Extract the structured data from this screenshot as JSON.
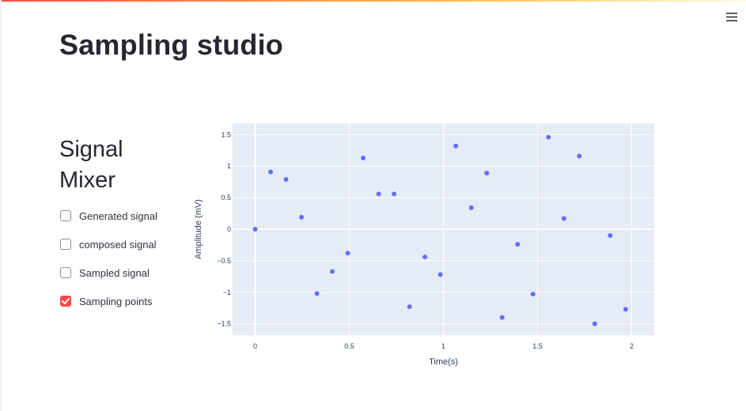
{
  "app": {
    "title": "Sampling studio",
    "menu_icon": "hamburger-menu-icon",
    "accent_color": "#ff4b4b"
  },
  "sidebar": {
    "heading": "Signal Mixer",
    "checkboxes": [
      {
        "label": "Generated signal",
        "checked": false
      },
      {
        "label": "composed signal",
        "checked": false
      },
      {
        "label": "Sampled signal",
        "checked": false
      },
      {
        "label": "Sampling points",
        "checked": true
      }
    ]
  },
  "chart_data": {
    "type": "scatter",
    "xlabel": "Time(s)",
    "ylabel": "Amplitude (mV)",
    "xlim": [
      -0.12,
      2.12
    ],
    "ylim": [
      -1.68,
      1.68
    ],
    "xticks": [
      {
        "value": 0,
        "label": "0"
      },
      {
        "value": 0.5,
        "label": "0.5"
      },
      {
        "value": 1,
        "label": "1"
      },
      {
        "value": 1.5,
        "label": "1.5"
      },
      {
        "value": 2,
        "label": "2"
      }
    ],
    "yticks": [
      {
        "value": 1.5,
        "label": "1.5"
      },
      {
        "value": 1,
        "label": "1"
      },
      {
        "value": 0.5,
        "label": "0.5"
      },
      {
        "value": 0,
        "label": "0"
      },
      {
        "value": -0.5,
        "label": "−0.5"
      },
      {
        "value": -1,
        "label": "−1"
      },
      {
        "value": -1.5,
        "label": "−1.5"
      }
    ],
    "grid": true,
    "marker_color": "#636efa",
    "plot_bg": "#e5ecf6",
    "series": [
      {
        "x": [
          0.0,
          0.082,
          0.164,
          0.246,
          0.328,
          0.41,
          0.492,
          0.574,
          0.656,
          0.738,
          0.82,
          0.902,
          0.984,
          1.066,
          1.148,
          1.23,
          1.312,
          1.394,
          1.476,
          1.558,
          1.64,
          1.722,
          1.804,
          1.886,
          1.968
        ],
        "y": [
          0.0,
          0.91,
          0.79,
          0.19,
          -1.02,
          -0.67,
          -0.38,
          1.13,
          0.56,
          0.56,
          -1.23,
          -0.44,
          -0.72,
          1.32,
          0.34,
          0.89,
          -1.4,
          -0.24,
          -1.03,
          1.46,
          0.17,
          1.16,
          -1.5,
          -0.1,
          -1.27
        ]
      }
    ]
  }
}
